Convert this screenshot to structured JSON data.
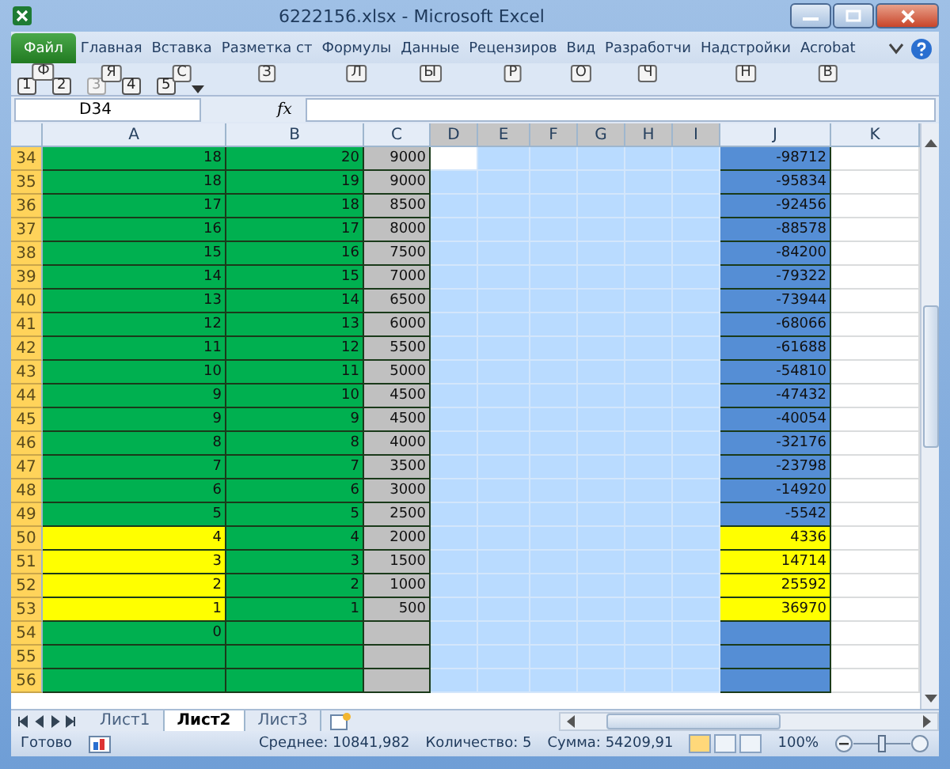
{
  "window": {
    "title": "6222156.xlsx - Microsoft Excel"
  },
  "ribbon_tabs": [
    {
      "label": "Файл",
      "kind": "file",
      "keytip": "Ф"
    },
    {
      "label": "Главная",
      "kind": "tab",
      "keytip": "Я"
    },
    {
      "label": "Вставка",
      "kind": "tab",
      "keytip": "С"
    },
    {
      "label": "Разметка ст",
      "kind": "tab",
      "keytip": "З"
    },
    {
      "label": "Формулы",
      "kind": "tab",
      "keytip": "Л"
    },
    {
      "label": "Данные",
      "kind": "tab",
      "keytip": "Ы"
    },
    {
      "label": "Рецензиров",
      "kind": "tab",
      "keytip": "Р"
    },
    {
      "label": "Вид",
      "kind": "tab",
      "keytip": "О"
    },
    {
      "label": "Разработчи",
      "kind": "tab",
      "keytip": "Ч"
    },
    {
      "label": "Надстройки",
      "kind": "tab",
      "keytip": "Н"
    },
    {
      "label": "Acrobat",
      "kind": "tab",
      "keytip": "В"
    }
  ],
  "quick_access": [
    {
      "keytip": "1",
      "disabled": false
    },
    {
      "keytip": "2",
      "disabled": false
    },
    {
      "keytip": "3",
      "disabled": true
    },
    {
      "keytip": "4",
      "disabled": false
    },
    {
      "keytip": "5",
      "disabled": false
    }
  ],
  "formula_bar": {
    "name_box": "D34",
    "fx": "fx"
  },
  "columns": [
    {
      "label": "A",
      "selected": false
    },
    {
      "label": "B",
      "selected": false
    },
    {
      "label": "C",
      "selected": false
    },
    {
      "label": "D",
      "selected": true
    },
    {
      "label": "E",
      "selected": true
    },
    {
      "label": "F",
      "selected": true
    },
    {
      "label": "G",
      "selected": true
    },
    {
      "label": "H",
      "selected": true
    },
    {
      "label": "I",
      "selected": true
    },
    {
      "label": "J",
      "selected": false
    },
    {
      "label": "K",
      "selected": false
    }
  ],
  "rows": [
    {
      "header": "34",
      "active": true,
      "cells": [
        {
          "value": "18",
          "color": "#00b050"
        },
        {
          "value": "20",
          "color": "#00b050"
        },
        {
          "value": "9000",
          "color": "#c0c0c0"
        },
        {
          "value": "-98712",
          "color": "#558ed5"
        }
      ]
    },
    {
      "header": "35",
      "active": false,
      "cells": [
        {
          "value": "18",
          "color": "#00b050"
        },
        {
          "value": "19",
          "color": "#00b050"
        },
        {
          "value": "9000",
          "color": "#c0c0c0"
        },
        {
          "value": "-95834",
          "color": "#558ed5"
        }
      ]
    },
    {
      "header": "36",
      "active": false,
      "cells": [
        {
          "value": "17",
          "color": "#00b050"
        },
        {
          "value": "18",
          "color": "#00b050"
        },
        {
          "value": "8500",
          "color": "#c0c0c0"
        },
        {
          "value": "-92456",
          "color": "#558ed5"
        }
      ]
    },
    {
      "header": "37",
      "active": false,
      "cells": [
        {
          "value": "16",
          "color": "#00b050"
        },
        {
          "value": "17",
          "color": "#00b050"
        },
        {
          "value": "8000",
          "color": "#c0c0c0"
        },
        {
          "value": "-88578",
          "color": "#558ed5"
        }
      ]
    },
    {
      "header": "38",
      "active": false,
      "cells": [
        {
          "value": "15",
          "color": "#00b050"
        },
        {
          "value": "16",
          "color": "#00b050"
        },
        {
          "value": "7500",
          "color": "#c0c0c0"
        },
        {
          "value": "-84200",
          "color": "#558ed5"
        }
      ]
    },
    {
      "header": "39",
      "active": false,
      "cells": [
        {
          "value": "14",
          "color": "#00b050"
        },
        {
          "value": "15",
          "color": "#00b050"
        },
        {
          "value": "7000",
          "color": "#c0c0c0"
        },
        {
          "value": "-79322",
          "color": "#558ed5"
        }
      ]
    },
    {
      "header": "40",
      "active": false,
      "cells": [
        {
          "value": "13",
          "color": "#00b050"
        },
        {
          "value": "14",
          "color": "#00b050"
        },
        {
          "value": "6500",
          "color": "#c0c0c0"
        },
        {
          "value": "-73944",
          "color": "#558ed5"
        }
      ]
    },
    {
      "header": "41",
      "active": false,
      "cells": [
        {
          "value": "12",
          "color": "#00b050"
        },
        {
          "value": "13",
          "color": "#00b050"
        },
        {
          "value": "6000",
          "color": "#c0c0c0"
        },
        {
          "value": "-68066",
          "color": "#558ed5"
        }
      ]
    },
    {
      "header": "42",
      "active": false,
      "cells": [
        {
          "value": "11",
          "color": "#00b050"
        },
        {
          "value": "12",
          "color": "#00b050"
        },
        {
          "value": "5500",
          "color": "#c0c0c0"
        },
        {
          "value": "-61688",
          "color": "#558ed5"
        }
      ]
    },
    {
      "header": "43",
      "active": false,
      "cells": [
        {
          "value": "10",
          "color": "#00b050"
        },
        {
          "value": "11",
          "color": "#00b050"
        },
        {
          "value": "5000",
          "color": "#c0c0c0"
        },
        {
          "value": "-54810",
          "color": "#558ed5"
        }
      ]
    },
    {
      "header": "44",
      "active": false,
      "cells": [
        {
          "value": "9",
          "color": "#00b050"
        },
        {
          "value": "10",
          "color": "#00b050"
        },
        {
          "value": "4500",
          "color": "#c0c0c0"
        },
        {
          "value": "-47432",
          "color": "#558ed5"
        }
      ]
    },
    {
      "header": "45",
      "active": false,
      "cells": [
        {
          "value": "9",
          "color": "#00b050"
        },
        {
          "value": "9",
          "color": "#00b050"
        },
        {
          "value": "4500",
          "color": "#c0c0c0"
        },
        {
          "value": "-40054",
          "color": "#558ed5"
        }
      ]
    },
    {
      "header": "46",
      "active": false,
      "cells": [
        {
          "value": "8",
          "color": "#00b050"
        },
        {
          "value": "8",
          "color": "#00b050"
        },
        {
          "value": "4000",
          "color": "#c0c0c0"
        },
        {
          "value": "-32176",
          "color": "#558ed5"
        }
      ]
    },
    {
      "header": "47",
      "active": false,
      "cells": [
        {
          "value": "7",
          "color": "#00b050"
        },
        {
          "value": "7",
          "color": "#00b050"
        },
        {
          "value": "3500",
          "color": "#c0c0c0"
        },
        {
          "value": "-23798",
          "color": "#558ed5"
        }
      ]
    },
    {
      "header": "48",
      "active": false,
      "cells": [
        {
          "value": "6",
          "color": "#00b050"
        },
        {
          "value": "6",
          "color": "#00b050"
        },
        {
          "value": "3000",
          "color": "#c0c0c0"
        },
        {
          "value": "-14920",
          "color": "#558ed5"
        }
      ]
    },
    {
      "header": "49",
      "active": false,
      "cells": [
        {
          "value": "5",
          "color": "#00b050"
        },
        {
          "value": "5",
          "color": "#00b050"
        },
        {
          "value": "2500",
          "color": "#c0c0c0"
        },
        {
          "value": "-5542",
          "color": "#558ed5"
        }
      ]
    },
    {
      "header": "50",
      "active": false,
      "cells": [
        {
          "value": "4",
          "color": "#ffff00"
        },
        {
          "value": "4",
          "color": "#00b050"
        },
        {
          "value": "2000",
          "color": "#c0c0c0"
        },
        {
          "value": "4336",
          "color": "#ffff00"
        }
      ]
    },
    {
      "header": "51",
      "active": false,
      "cells": [
        {
          "value": "3",
          "color": "#ffff00"
        },
        {
          "value": "3",
          "color": "#00b050"
        },
        {
          "value": "1500",
          "color": "#c0c0c0"
        },
        {
          "value": "14714",
          "color": "#ffff00"
        }
      ]
    },
    {
      "header": "52",
      "active": false,
      "cells": [
        {
          "value": "2",
          "color": "#ffff00"
        },
        {
          "value": "2",
          "color": "#00b050"
        },
        {
          "value": "1000",
          "color": "#c0c0c0"
        },
        {
          "value": "25592",
          "color": "#ffff00"
        }
      ]
    },
    {
      "header": "53",
      "active": false,
      "cells": [
        {
          "value": "1",
          "color": "#ffff00"
        },
        {
          "value": "1",
          "color": "#00b050"
        },
        {
          "value": "500",
          "color": "#c0c0c0"
        },
        {
          "value": "36970",
          "color": "#ffff00"
        }
      ]
    },
    {
      "header": "54",
      "active": false,
      "cells": [
        {
          "value": "0",
          "color": "#00b050"
        },
        {
          "color": "#00b050"
        },
        {
          "color": "#c0c0c0"
        },
        {
          "color": "#558ed5"
        }
      ]
    },
    {
      "header": "55",
      "active": false,
      "cells": [
        {
          "color": "#00b050"
        },
        {
          "color": "#00b050"
        },
        {
          "color": "#c0c0c0"
        },
        {
          "color": "#558ed5"
        }
      ]
    },
    {
      "header": "56",
      "active": false,
      "cells": [
        {
          "color": "#00b050"
        },
        {
          "color": "#00b050"
        },
        {
          "color": "#c0c0c0"
        },
        {
          "color": "#558ed5"
        }
      ]
    }
  ],
  "sheet_tabs": [
    {
      "label": "Лист1",
      "selected": false
    },
    {
      "label": "Лист2",
      "selected": true
    },
    {
      "label": "Лист3",
      "selected": false
    }
  ],
  "status_bar": {
    "mode": "Готово",
    "average": "Среднее: 10841,982",
    "count": "Количество: 5",
    "sum": "Сумма: 54209,91",
    "zoom": "100%",
    "zoom_slider": {
      "level": 0.5
    }
  }
}
